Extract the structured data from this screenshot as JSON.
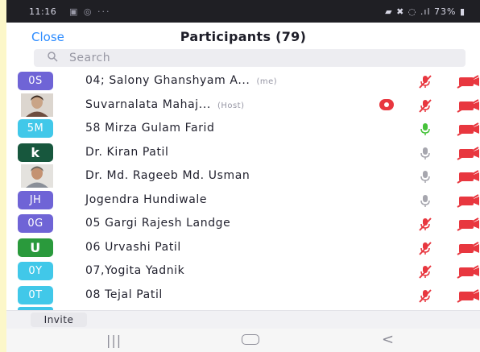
{
  "status_bar": {
    "time": "11:16",
    "left_icons": "▣ ◎  ···",
    "right_icons": "▰ ✖ ◌ .ıl 73% ▮"
  },
  "header": {
    "close_label": "Close",
    "title": "Participants (79)"
  },
  "search": {
    "placeholder": "Search"
  },
  "participants": [
    {
      "initials": "0S",
      "name": "04; Salony Ghanshyam A...",
      "tag": "(me)",
      "avatar_color": "#6f64d6",
      "mic": "muted",
      "photo": false
    },
    {
      "initials": "",
      "name": "Suvarnalata Mahaj...",
      "tag": "(Host)",
      "avatar_color": "#8a7766",
      "mic": "muted",
      "photo": true,
      "recording": true
    },
    {
      "initials": "5M",
      "name": "58 Mirza Gulam Farid",
      "tag": "",
      "avatar_color": "#41c8e9",
      "mic": "on",
      "photo": false
    },
    {
      "initials": "k",
      "name": "Dr. Kiran Patil",
      "tag": "",
      "avatar_color": "#17573d",
      "mic": "none",
      "photo": false
    },
    {
      "initials": "",
      "name": "Dr. Md. Rageeb Md. Usman",
      "tag": "",
      "avatar_color": "#a08a74",
      "mic": "none",
      "photo": true
    },
    {
      "initials": "JH",
      "name": "Jogendra Hundiwale",
      "tag": "",
      "avatar_color": "#6f64d6",
      "mic": "none",
      "photo": false
    },
    {
      "initials": "0G",
      "name": "05 Gargi Rajesh Landge",
      "tag": "",
      "avatar_color": "#6f64d6",
      "mic": "muted",
      "photo": false
    },
    {
      "initials": "U",
      "name": "06 Urvashi Patil",
      "tag": "",
      "avatar_color": "#2a9a3c",
      "mic": "muted",
      "photo": false
    },
    {
      "initials": "0Y",
      "name": "07,Yogita Yadnik",
      "tag": "",
      "avatar_color": "#41c8e9",
      "mic": "muted",
      "photo": false
    },
    {
      "initials": "0T",
      "name": "08 Tejal Patil",
      "tag": "",
      "avatar_color": "#41c8e9",
      "mic": "muted",
      "photo": false
    }
  ],
  "footer": {
    "invite_label": "Invite"
  },
  "colors": {
    "accent": "#2d8cff",
    "muted_red": "#e8373f",
    "mic_on_green": "#46c23a",
    "mic_idle_gray": "#a6a6ae"
  }
}
